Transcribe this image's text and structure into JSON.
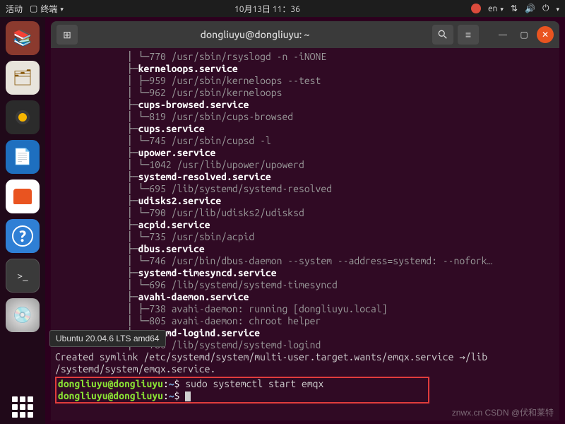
{
  "topbar": {
    "activities": "活动",
    "app_menu": "终端",
    "datetime": "10月13日 11：36",
    "lang": "en",
    "icons": [
      "update",
      "lang",
      "network",
      "volume",
      "power"
    ]
  },
  "dock": {
    "items": [
      "books",
      "files",
      "rhythmbox",
      "libreoffice",
      "software",
      "help",
      "terminal",
      "dvd",
      "apps"
    ]
  },
  "tooltip": "Ubuntu 20.04.6 LTS amd64",
  "window": {
    "title": "dongliuyu@dongliuyu: ~",
    "buttons": [
      "new-tab",
      "search",
      "menu",
      "minimize",
      "maximize",
      "close"
    ]
  },
  "terminal": {
    "services": [
      {
        "name": "",
        "procs": [
          {
            "pid": "770",
            "cmd": "/usr/sbin/rsyslogd -n -iNONE"
          }
        ]
      },
      {
        "name": "kerneloops.service",
        "procs": [
          {
            "pid": "959",
            "cmd": "/usr/sbin/kerneloops --test"
          },
          {
            "pid": "962",
            "cmd": "/usr/sbin/kerneloops"
          }
        ]
      },
      {
        "name": "cups-browsed.service",
        "procs": [
          {
            "pid": "819",
            "cmd": "/usr/sbin/cups-browsed"
          }
        ]
      },
      {
        "name": "cups.service",
        "procs": [
          {
            "pid": "745",
            "cmd": "/usr/sbin/cupsd -l"
          }
        ]
      },
      {
        "name": "upower.service",
        "procs": [
          {
            "pid": "1042",
            "cmd": "/usr/lib/upower/upowerd"
          }
        ]
      },
      {
        "name": "systemd-resolved.service",
        "procs": [
          {
            "pid": "695",
            "cmd": "/lib/systemd/systemd-resolved"
          }
        ]
      },
      {
        "name": "udisks2.service",
        "procs": [
          {
            "pid": "790",
            "cmd": "/usr/lib/udisks2/udisksd"
          }
        ]
      },
      {
        "name": "acpid.service",
        "procs": [
          {
            "pid": "735",
            "cmd": "/usr/sbin/acpid"
          }
        ]
      },
      {
        "name": "dbus.service",
        "procs": [
          {
            "pid": "746",
            "cmd": "/usr/bin/dbus-daemon --system --address=systemd: --nofork…"
          }
        ]
      },
      {
        "name": "systemd-timesyncd.service",
        "procs": [
          {
            "pid": "696",
            "cmd": "/lib/systemd/systemd-timesyncd"
          }
        ]
      },
      {
        "name": "avahi-daemon.service",
        "procs": [
          {
            "pid": "738",
            "cmd": "avahi-daemon: running [dongliuyu.local]"
          },
          {
            "pid": "805",
            "cmd": "avahi-daemon: chroot helper"
          }
        ]
      },
      {
        "name": "systemd-logind.service",
        "procs": [
          {
            "pid": "786",
            "cmd": "/lib/systemd/systemd-logind"
          }
        ],
        "last": true
      }
    ],
    "symlink_line": "Created symlink /etc/systemd/system/multi-user.target.wants/emqx.service →/lib\n/systemd/system/emqx.service.",
    "prompt": {
      "user": "dongliuyu",
      "host": "dongliuyu",
      "path": "~",
      "sep": "@",
      "sym": "$"
    },
    "command": "sudo systemctl start emqx"
  },
  "watermark": "znwx.cn\nCSDN @伏和莱特"
}
